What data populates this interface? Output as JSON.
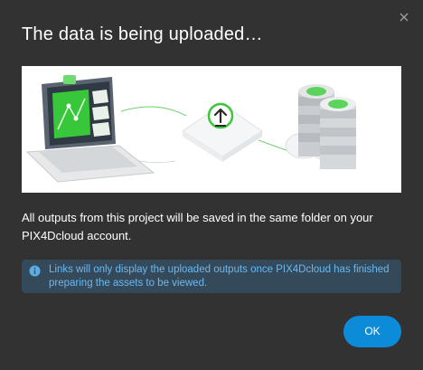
{
  "dialog": {
    "title": "The data is being uploaded…",
    "close_icon": "close-icon",
    "illustration": {
      "description_icons": [
        "laptop-icon",
        "upload-icon",
        "server-icon",
        "cloud-icon"
      ],
      "accent_color": "#3cc63c"
    },
    "message": "All outputs from this project will be saved in the same folder on your PIX4Dcloud account.",
    "info": {
      "icon": "info-icon",
      "text": "Links will only display the uploaded outputs once PIX4Dcloud has finished preparing the assets to be viewed.",
      "text_color": "#6cb8f0",
      "background_color": "#34495a"
    },
    "ok_button_label": "OK",
    "ok_button_color": "#0c8bd9",
    "background_color": "#323232"
  }
}
